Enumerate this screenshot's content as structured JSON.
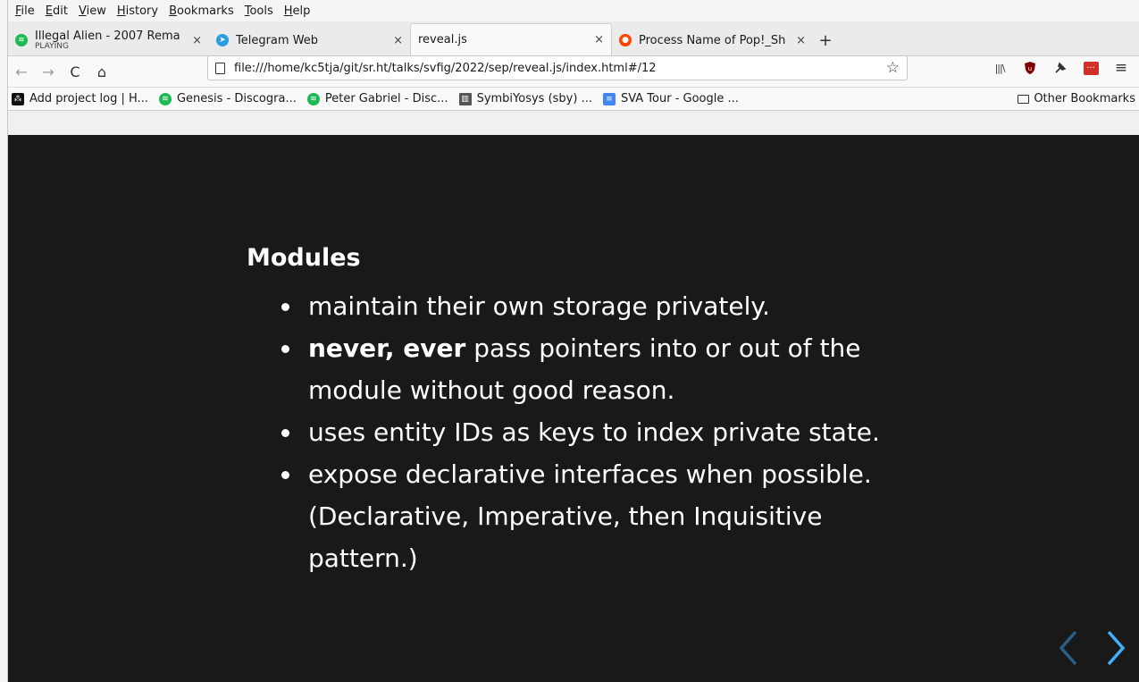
{
  "menu": [
    "File",
    "Edit",
    "View",
    "History",
    "Bookmarks",
    "Tools",
    "Help"
  ],
  "tabs": [
    {
      "label": "Illegal Alien - 2007 Rema",
      "sub": "PLAYING",
      "icon": "spotify-icon",
      "color": "#1db954",
      "close": "×"
    },
    {
      "label": "Telegram Web",
      "icon": "telegram-icon",
      "color": "#2a9ee0",
      "close": "×"
    },
    {
      "label": "reveal.js",
      "active": true,
      "close": "×"
    },
    {
      "label": "Process Name of Pop!_Sh",
      "icon": "reddit-icon",
      "color": "#ff4500",
      "close": "×"
    }
  ],
  "newtab": "+",
  "nav": {
    "back": "←",
    "forward": "→",
    "reload": "C",
    "home": "⌂"
  },
  "url": "file:///home/kc5tja/git/sr.ht/talks/svfig/2022/sep/reveal.js/index.html#/12",
  "star": "☆",
  "toolbar": {
    "library": "|||\\",
    "ublock": "ublock-icon",
    "pin": "pin-icon",
    "lastpass": "···",
    "menu": "≡"
  },
  "bookmarks": [
    {
      "label": "Add project log | H...",
      "icon": "hackaday-icon",
      "color": "#111"
    },
    {
      "label": "Genesis - Discogra...",
      "icon": "spotify-icon",
      "color": "#1db954"
    },
    {
      "label": "Peter Gabriel - Disc...",
      "icon": "spotify-icon",
      "color": "#1db954"
    },
    {
      "label": "SymbiYosys (sby) ...",
      "icon": "book-icon",
      "color": "#555"
    },
    {
      "label": "SVA Tour - Google ...",
      "icon": "docs-icon",
      "color": "#4285f4"
    }
  ],
  "other_bookmarks": "Other Bookmarks",
  "slide": {
    "title": "Modules",
    "b1": "maintain their own storage privately.",
    "b2_bold": "never, ever",
    "b2_rest": " pass pointers into or out of the module without good reason.",
    "b3": "uses entity IDs as keys to index private state.",
    "b4": "expose declarative interfaces when possible. (Declarative, Imperative, then Inquisitive pattern.)"
  },
  "colors": {
    "slide_bg": "#191919",
    "control_active": "#42affa",
    "control_dim": "#2a5f85"
  }
}
